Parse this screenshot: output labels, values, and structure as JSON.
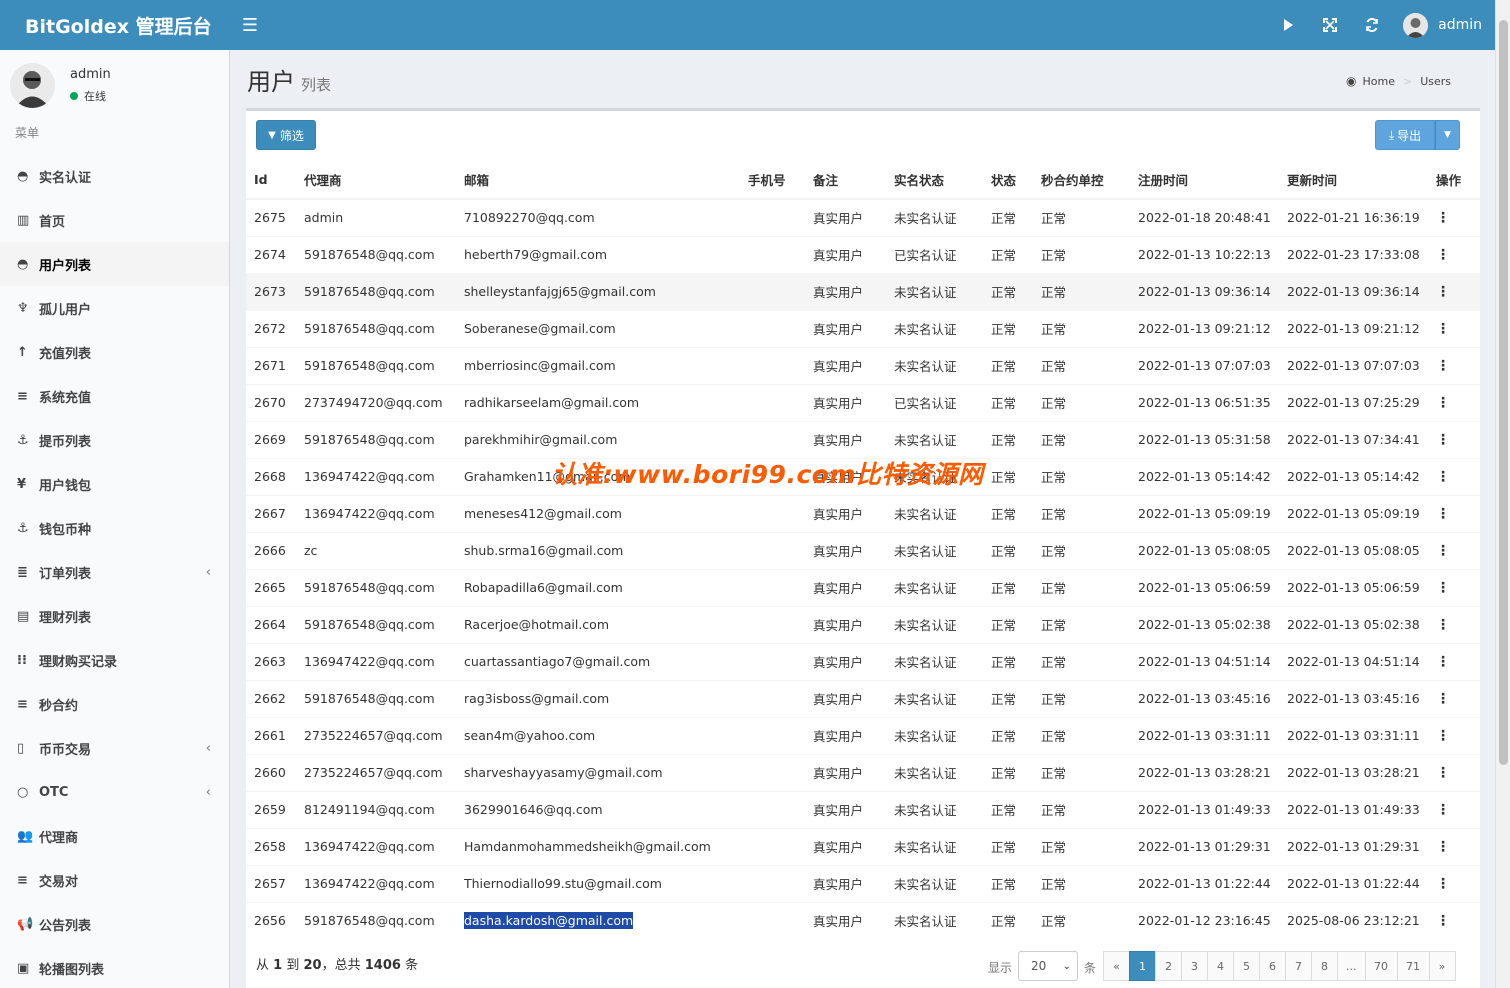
{
  "header": {
    "brand": "BitGoldex 管理后台",
    "user_name": "admin"
  },
  "sidebar": {
    "user": {
      "name": "admin",
      "status": "在线"
    },
    "menu_header": "菜单",
    "items": [
      {
        "label": "实名认证",
        "icon": "◓",
        "active": false,
        "chevron": false
      },
      {
        "label": "首页",
        "icon": "▥",
        "active": false,
        "chevron": false
      },
      {
        "label": "用户列表",
        "icon": "◓",
        "active": true,
        "chevron": false
      },
      {
        "label": "孤儿用户",
        "icon": "♆",
        "active": false,
        "chevron": false
      },
      {
        "label": "充值列表",
        "icon": "↑",
        "active": false,
        "chevron": false
      },
      {
        "label": "系统充值",
        "icon": "≡",
        "active": false,
        "chevron": false
      },
      {
        "label": "提币列表",
        "icon": "⚓",
        "active": false,
        "chevron": false
      },
      {
        "label": "用户钱包",
        "icon": "¥",
        "active": false,
        "chevron": false
      },
      {
        "label": "钱包币种",
        "icon": "⚓",
        "active": false,
        "chevron": false
      },
      {
        "label": "订单列表",
        "icon": "≣",
        "active": false,
        "chevron": true
      },
      {
        "label": "理财列表",
        "icon": "▤",
        "active": false,
        "chevron": false
      },
      {
        "label": "理财购买记录",
        "icon": "⁝⁝",
        "active": false,
        "chevron": false
      },
      {
        "label": "秒合约",
        "icon": "≡",
        "active": false,
        "chevron": false
      },
      {
        "label": "币币交易",
        "icon": "▯",
        "active": false,
        "chevron": true
      },
      {
        "label": "OTC",
        "icon": "○",
        "active": false,
        "chevron": true
      },
      {
        "label": "代理商",
        "icon": "👥",
        "active": false,
        "chevron": false
      },
      {
        "label": "交易对",
        "icon": "≡",
        "active": false,
        "chevron": false
      },
      {
        "label": "公告列表",
        "icon": "📢",
        "active": false,
        "chevron": false
      },
      {
        "label": "轮播图列表",
        "icon": "▣",
        "active": false,
        "chevron": false
      }
    ]
  },
  "page": {
    "title": "用户",
    "subtitle": "列表"
  },
  "breadcrumb": {
    "home": "Home",
    "current": "Users"
  },
  "toolbar": {
    "filter_label": "筛选",
    "export_label": "导出"
  },
  "table": {
    "columns": [
      "Id",
      "代理商",
      "邮箱",
      "手机号",
      "备注",
      "实名状态",
      "状态",
      "秒合约单控",
      "注册时间",
      "更新时间",
      "操作"
    ],
    "rows": [
      [
        "2675",
        "admin",
        "710892270@qq.com",
        "",
        "真实用户",
        "未实名认证",
        "正常",
        "正常",
        "2022-01-18 20:48:41",
        "2022-01-21 16:36:19"
      ],
      [
        "2674",
        "591876548@qq.com",
        "heberth79@gmail.com",
        "",
        "真实用户",
        "已实名认证",
        "正常",
        "正常",
        "2022-01-13 10:22:13",
        "2022-01-23 17:33:08"
      ],
      [
        "2673",
        "591876548@qq.com",
        "shelleystanfajgj65@gmail.com",
        "",
        "真实用户",
        "未实名认证",
        "正常",
        "正常",
        "2022-01-13 09:36:14",
        "2022-01-13 09:36:14"
      ],
      [
        "2672",
        "591876548@qq.com",
        "Soberanese@gmail.com",
        "",
        "真实用户",
        "未实名认证",
        "正常",
        "正常",
        "2022-01-13 09:21:12",
        "2022-01-13 09:21:12"
      ],
      [
        "2671",
        "591876548@qq.com",
        "mberriosinc@gmail.com",
        "",
        "真实用户",
        "未实名认证",
        "正常",
        "正常",
        "2022-01-13 07:07:03",
        "2022-01-13 07:07:03"
      ],
      [
        "2670",
        "2737494720@qq.com",
        "radhikarseelam@gmail.com",
        "",
        "真实用户",
        "已实名认证",
        "正常",
        "正常",
        "2022-01-13 06:51:35",
        "2022-01-13 07:25:29"
      ],
      [
        "2669",
        "591876548@qq.com",
        "parekhmihir@gmail.com",
        "",
        "真实用户",
        "未实名认证",
        "正常",
        "正常",
        "2022-01-13 05:31:58",
        "2022-01-13 07:34:41"
      ],
      [
        "2668",
        "136947422@qq.com",
        "Grahamken11@gmail.com",
        "",
        "真实用户",
        "未实名认证",
        "正常",
        "正常",
        "2022-01-13 05:14:42",
        "2022-01-13 05:14:42"
      ],
      [
        "2667",
        "136947422@qq.com",
        "meneses412@gmail.com",
        "",
        "真实用户",
        "未实名认证",
        "正常",
        "正常",
        "2022-01-13 05:09:19",
        "2022-01-13 05:09:19"
      ],
      [
        "2666",
        "zc",
        "shub.srma16@gmail.com",
        "",
        "真实用户",
        "未实名认证",
        "正常",
        "正常",
        "2022-01-13 05:08:05",
        "2022-01-13 05:08:05"
      ],
      [
        "2665",
        "591876548@qq.com",
        "Robapadilla6@gmail.com",
        "",
        "真实用户",
        "未实名认证",
        "正常",
        "正常",
        "2022-01-13 05:06:59",
        "2022-01-13 05:06:59"
      ],
      [
        "2664",
        "591876548@qq.com",
        "Racerjoe@hotmail.com",
        "",
        "真实用户",
        "未实名认证",
        "正常",
        "正常",
        "2022-01-13 05:02:38",
        "2022-01-13 05:02:38"
      ],
      [
        "2663",
        "136947422@qq.com",
        "cuartassantiago7@gmail.com",
        "",
        "真实用户",
        "未实名认证",
        "正常",
        "正常",
        "2022-01-13 04:51:14",
        "2022-01-13 04:51:14"
      ],
      [
        "2662",
        "591876548@qq.com",
        "rag3isboss@gmail.com",
        "",
        "真实用户",
        "未实名认证",
        "正常",
        "正常",
        "2022-01-13 03:45:16",
        "2022-01-13 03:45:16"
      ],
      [
        "2661",
        "2735224657@qq.com",
        "sean4m@yahoo.com",
        "",
        "真实用户",
        "未实名认证",
        "正常",
        "正常",
        "2022-01-13 03:31:11",
        "2022-01-13 03:31:11"
      ],
      [
        "2660",
        "2735224657@qq.com",
        "sharveshayyasamy@gmail.com",
        "",
        "真实用户",
        "未实名认证",
        "正常",
        "正常",
        "2022-01-13 03:28:21",
        "2022-01-13 03:28:21"
      ],
      [
        "2659",
        "812491194@qq.com",
        "3629901646@qq.com",
        "",
        "真实用户",
        "未实名认证",
        "正常",
        "正常",
        "2022-01-13 01:49:33",
        "2022-01-13 01:49:33"
      ],
      [
        "2658",
        "136947422@qq.com",
        "Hamdanmohammedsheikh@gmail.com",
        "",
        "真实用户",
        "未实名认证",
        "正常",
        "正常",
        "2022-01-13 01:29:31",
        "2022-01-13 01:29:31"
      ],
      [
        "2657",
        "136947422@qq.com",
        "Thiernodiallo99.stu@gmail.com",
        "",
        "真实用户",
        "未实名认证",
        "正常",
        "正常",
        "2022-01-13 01:22:44",
        "2022-01-13 01:22:44"
      ],
      [
        "2656",
        "591876548@qq.com",
        "dasha.kardosh@gmail.com",
        "",
        "真实用户",
        "未实名认证",
        "正常",
        "正常",
        "2022-01-12 23:16:45",
        "2025-08-06 23:12:21"
      ]
    ],
    "highlight_row": 2,
    "selected_row": 19
  },
  "footer": {
    "info_prefix": "从",
    "from": "1",
    "to_word": "到",
    "to": "20",
    "total_prefix": "，总共",
    "total": "1406",
    "unit": "条",
    "show_label": "显示",
    "page_size": "20",
    "page_size_unit": "条",
    "pages": [
      "«",
      "1",
      "2",
      "3",
      "4",
      "5",
      "6",
      "7",
      "8",
      "...",
      "70",
      "71",
      "»"
    ],
    "current_page": "1"
  },
  "watermark": "认准:www.bori99.com比特资源网",
  "colors": {
    "primary": "#3c8dbc",
    "sidebar_bg": "#f9fafc",
    "content_bg": "#ecf0f5",
    "online": "#00a65a",
    "watermark": "#ff5a00"
  }
}
